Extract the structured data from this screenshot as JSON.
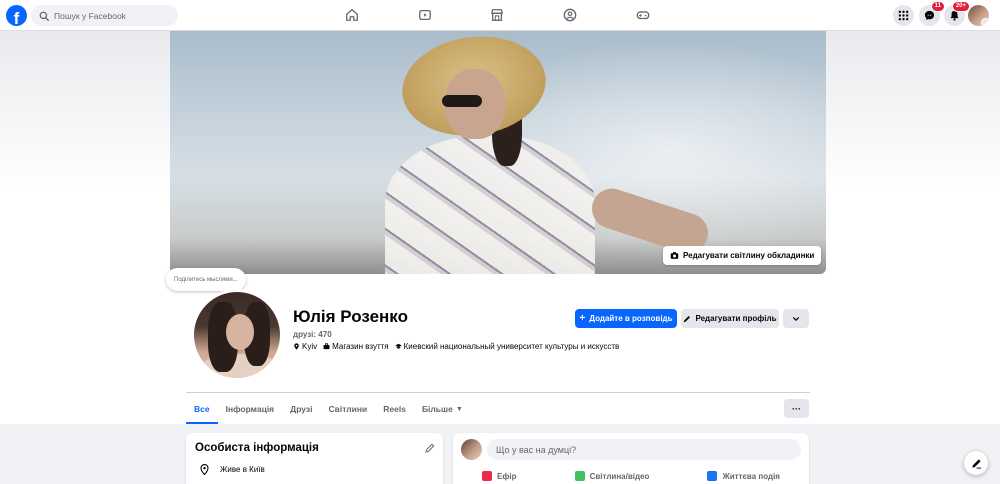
{
  "topbar": {
    "logo_letter": "f",
    "search_placeholder": "Пошук у Facebook",
    "messenger_badge": "11",
    "notifications_badge": "20+"
  },
  "cover": {
    "edit_button_label": "Редагувати світлину обкладинки"
  },
  "profile": {
    "thought_prompt": "Поділитесь мыслями...",
    "name": "Юлія Розенко",
    "friends": "друзі: 470",
    "location": "Kyiv",
    "workplace": "Магазин взуття",
    "education": "Киевский национальный университет культуры и искусств",
    "add_story_label": "Додайте в розповідь",
    "edit_profile_label": "Редагувати профіль"
  },
  "tabs": [
    {
      "label": "Все",
      "active": true
    },
    {
      "label": "Інформація"
    },
    {
      "label": "Друзі"
    },
    {
      "label": "Світлини"
    },
    {
      "label": "Reels"
    },
    {
      "label": "Більше"
    }
  ],
  "tabs_more_label": "···",
  "intro": {
    "title": "Особиста інформація",
    "lives_in": "Живе в Київ"
  },
  "composer": {
    "placeholder": "Що у вас на думці?",
    "actions": [
      {
        "label": "Ефір",
        "color": "#f02849"
      },
      {
        "label": "Світлина/відео",
        "color": "#45bd62"
      },
      {
        "label": "Життєва подія",
        "color": "#1877f2"
      }
    ]
  },
  "colors": {
    "accent": "#0866ff",
    "badge": "#e41e3f"
  }
}
